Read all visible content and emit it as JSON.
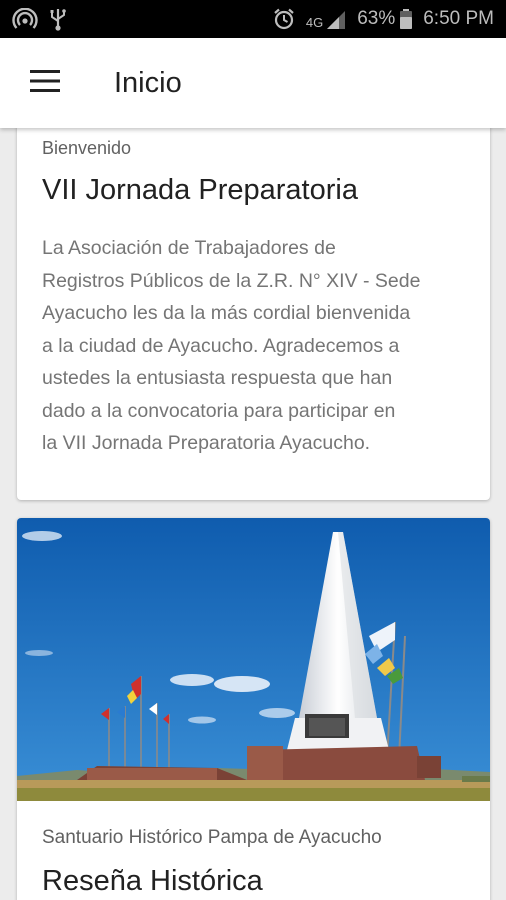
{
  "status_bar": {
    "battery_percent": "63%",
    "network": "4G",
    "time": "6:50 PM",
    "icons": [
      "wifi-hotspot-icon",
      "usb-icon",
      "alarm-icon",
      "signal-icon",
      "battery-icon"
    ]
  },
  "app_bar": {
    "title": "Inicio",
    "menu_icon": "hamburger-menu-icon"
  },
  "cards": [
    {
      "overline": "Bienvenido",
      "title": "VII Jornada Preparatoria",
      "body_lines": [
        "La Asociación de Trabajadores de",
        "Registros Públicos de la Z.R. N° XIV - Sede",
        "Ayacucho les da la más cordial bienvenida",
        "a la ciudad de Ayacucho. Agradecemos a",
        "ustedes la entusiasta respuesta que han",
        "dado a la convocatoria para participar en",
        "la VII Jornada Preparatoria Ayacucho."
      ]
    },
    {
      "image": "obelisk-monument-photo",
      "overline": "Santuario Histórico Pampa de Ayacucho",
      "title": "Reseña Histórica"
    }
  ],
  "colors": {
    "status_bar": "#000000",
    "app_bar": "#ffffff",
    "background": "#ececec",
    "sky": "#1b6fc0"
  }
}
